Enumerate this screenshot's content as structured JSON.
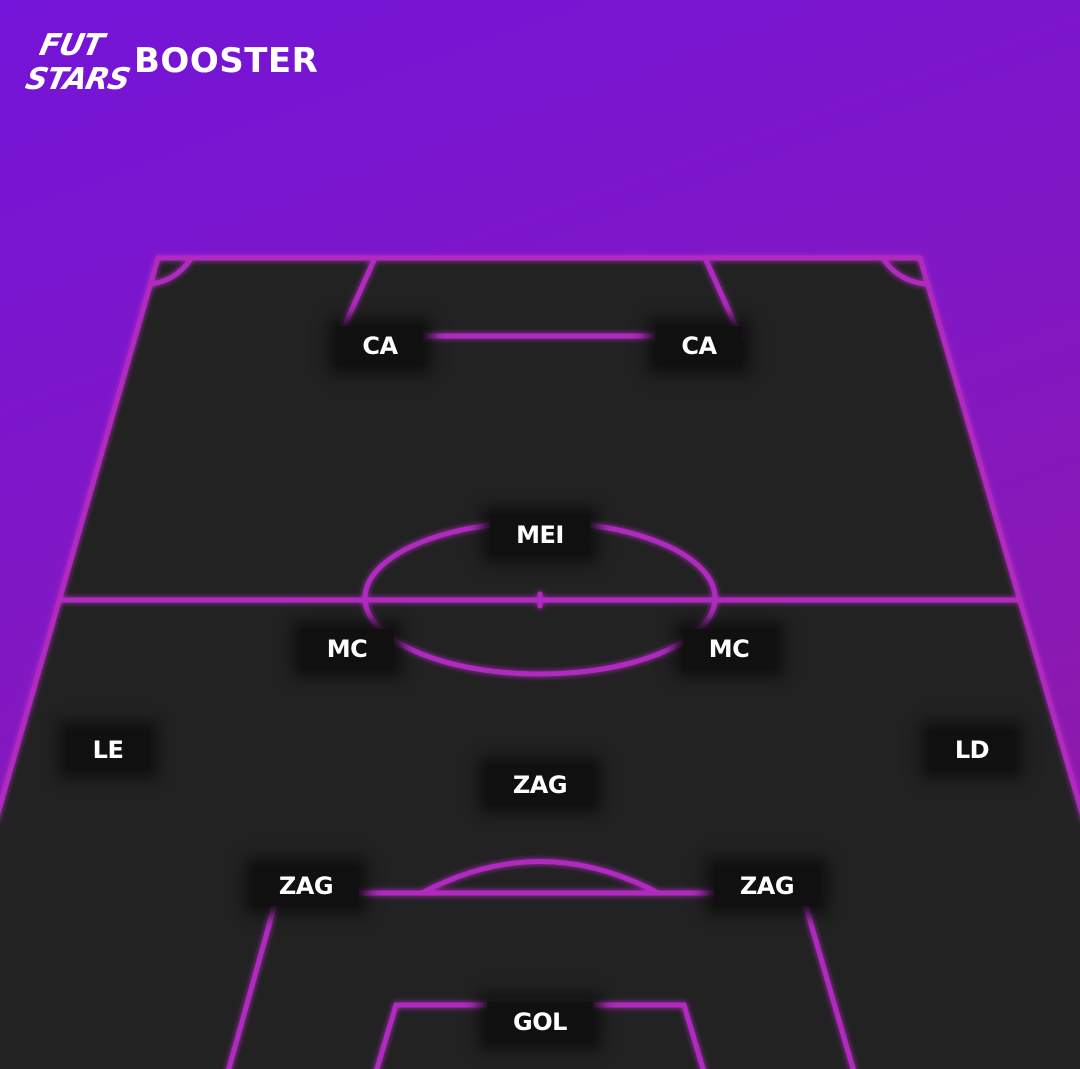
{
  "brand": {
    "logo_line1": "FUT",
    "logo_line2": "STARS",
    "title": "BOOSTER"
  },
  "colors": {
    "background_top": "#7414d8",
    "background_bottom": "#941a9e",
    "pitch": "#222222",
    "pitch_lines": "#b02ac0",
    "badge": "#101010",
    "text": "#ffffff"
  },
  "positions": {
    "ca_left": "CA",
    "ca_right": "CA",
    "mei": "MEI",
    "mc_left": "MC",
    "mc_right": "MC",
    "le": "LE",
    "ld": "LD",
    "zag_center": "ZAG",
    "zag_left": "ZAG",
    "zag_right": "ZAG",
    "gol": "GOL"
  }
}
